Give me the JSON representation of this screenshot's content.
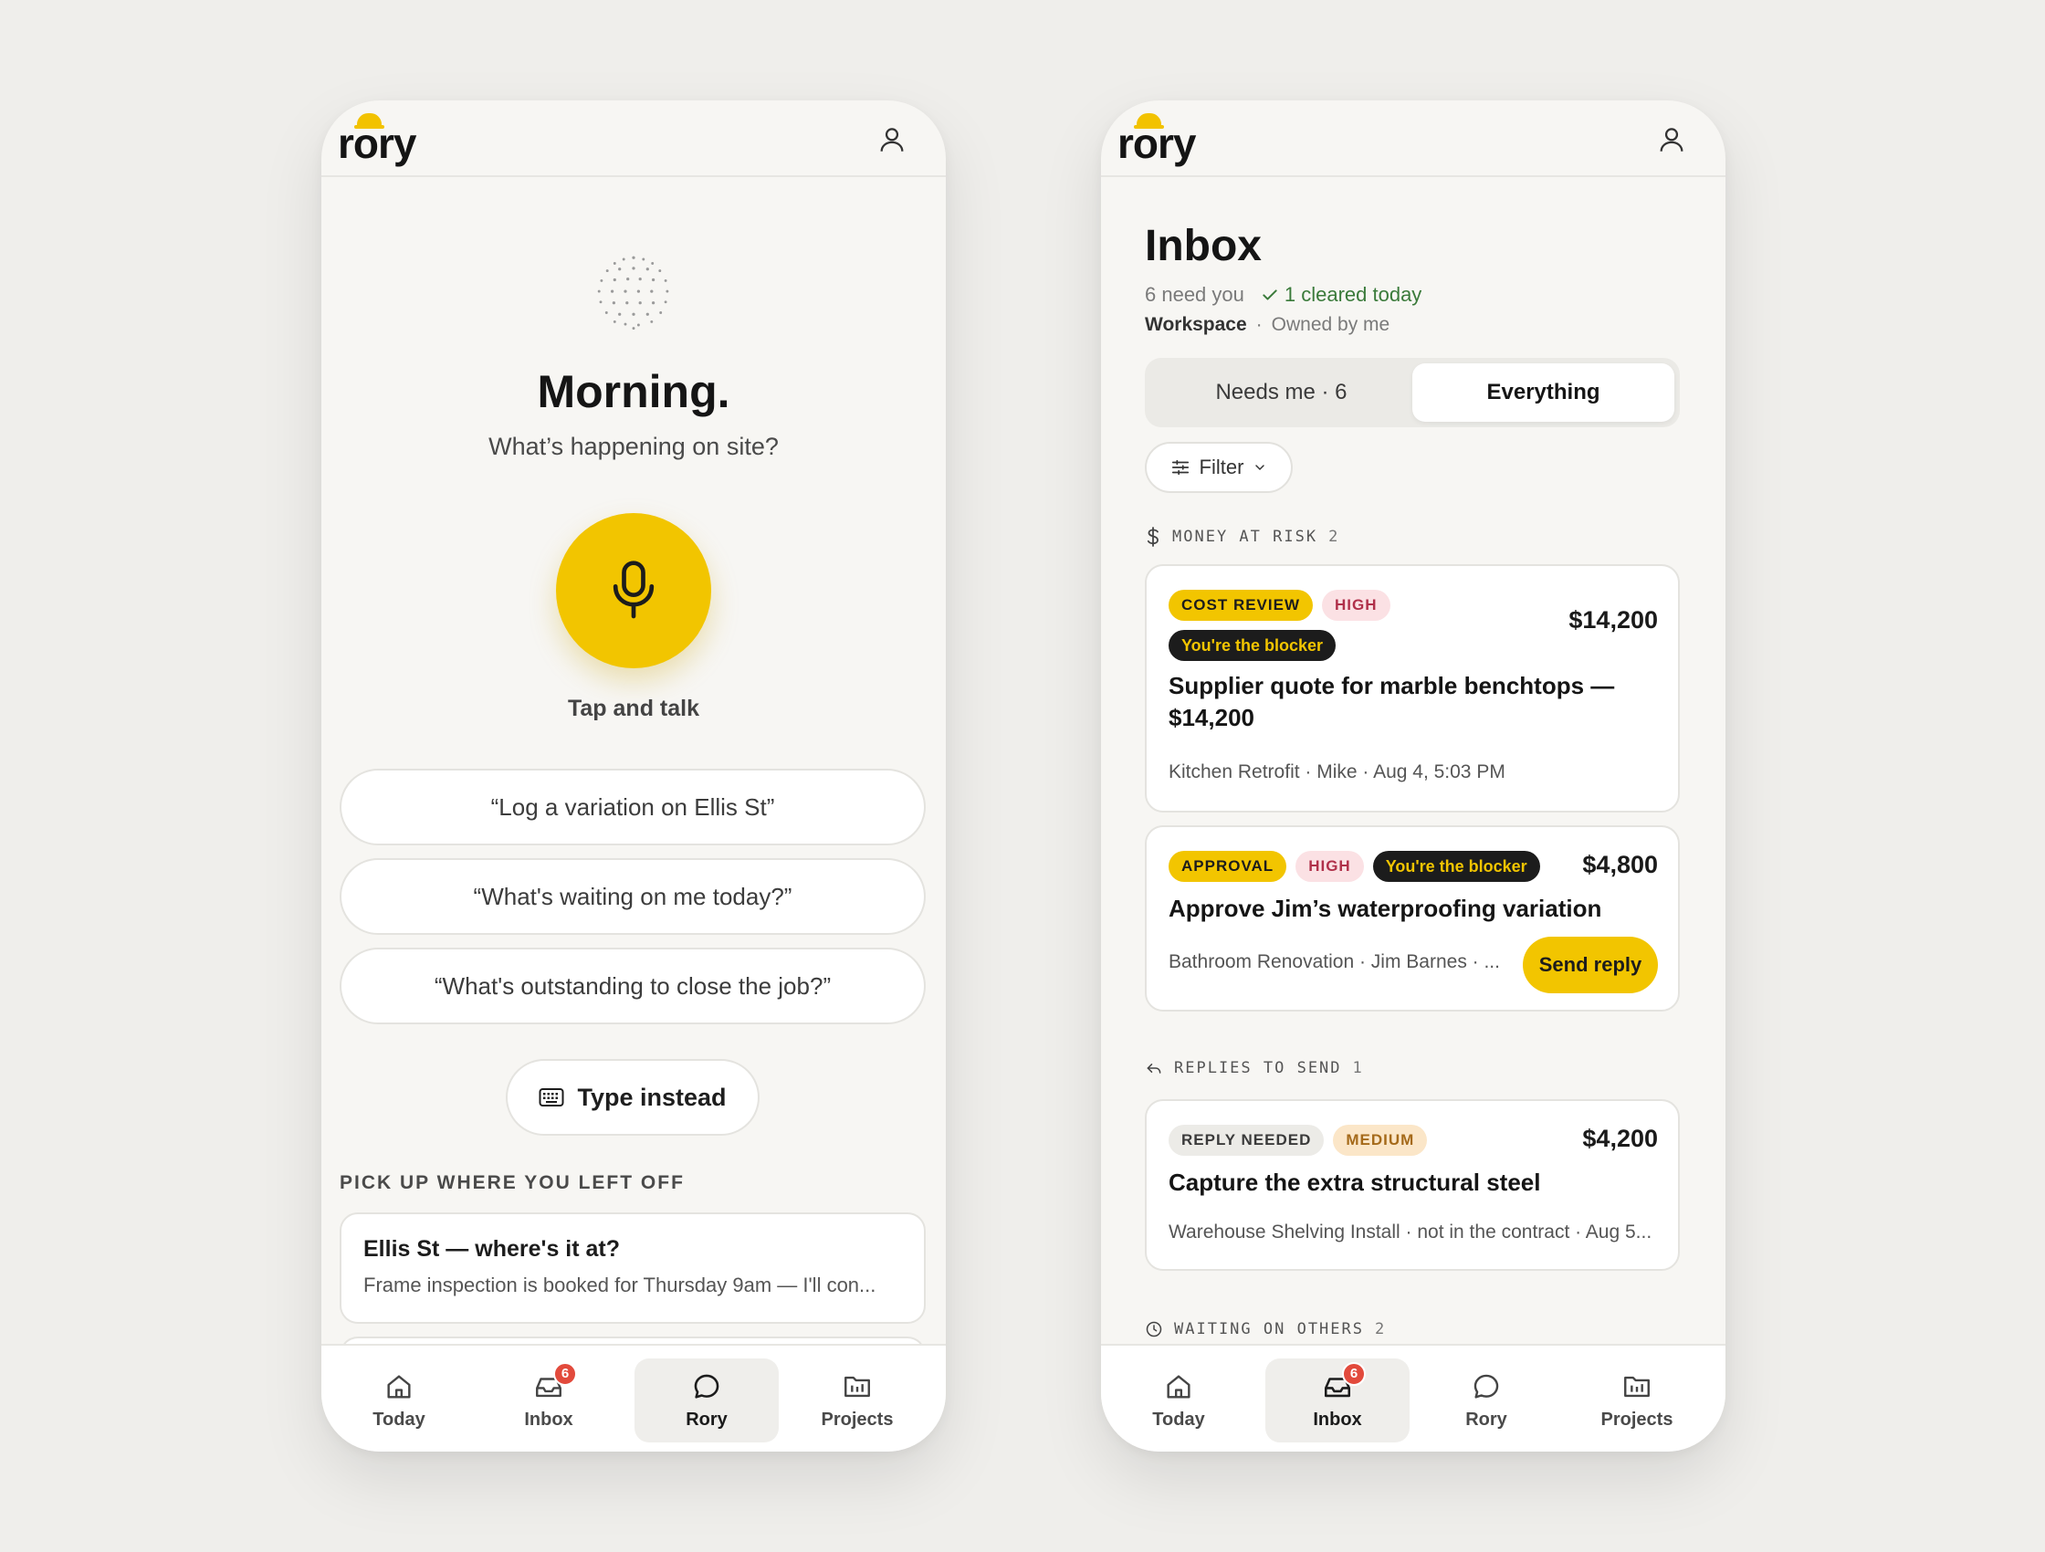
{
  "brand": {
    "name": "rory",
    "accent": "#f2c500"
  },
  "left": {
    "greeting": "Morning.",
    "subtitle": "What’s happening on site?",
    "mic_label": "Tap and talk",
    "suggestions": [
      "“Log a variation on Ellis St”",
      "“What's waiting on me today?”",
      "“What's outstanding to close the job?”"
    ],
    "type_instead": "Type instead",
    "resume_caption": "PICK UP WHERE YOU LEFT OFF",
    "resume_card": {
      "title": "Ellis St — where's it at?",
      "body": "Frame inspection is booked for Thursday 9am — I'll con..."
    }
  },
  "right": {
    "title": "Inbox",
    "need_you": "6 need you",
    "cleared": "1 cleared today",
    "scope_active": "Workspace",
    "scope_sep": "·",
    "scope_other": "Owned by me",
    "segments": [
      "Needs me · 6",
      "Everything"
    ],
    "filter_label": "Filter",
    "groups": [
      {
        "title": "MONEY AT RISK",
        "count": "2"
      },
      {
        "title": "REPLIES TO SEND",
        "count": "1"
      },
      {
        "title": "WAITING ON OTHERS",
        "count": "2"
      }
    ],
    "cards": [
      {
        "chips": [
          "COST REVIEW",
          "HIGH",
          "You're the blocker"
        ],
        "amount": "$14,200",
        "title": "Supplier quote for marble benchtops — $14,200",
        "meta": "Kitchen Retrofit · Mike · Aug 4, 5:03 PM"
      },
      {
        "chips": [
          "APPROVAL",
          "HIGH",
          "You're the blocker"
        ],
        "amount": "$4,800",
        "title": "Approve Jim’s waterproofing variation",
        "meta": "Bathroom Renovation · Jim Barnes · ...",
        "action": "Send reply"
      },
      {
        "chips": [
          "REPLY NEEDED",
          "MEDIUM"
        ],
        "amount": "$4,200",
        "title": "Capture the extra structural steel",
        "meta": "Warehouse Shelving Install · not in the contract · Aug 5..."
      }
    ]
  },
  "nav": {
    "items": [
      "Today",
      "Inbox",
      "Rory",
      "Projects"
    ],
    "inbox_badge": "6",
    "left_active": "Rory",
    "right_active": "Inbox"
  }
}
